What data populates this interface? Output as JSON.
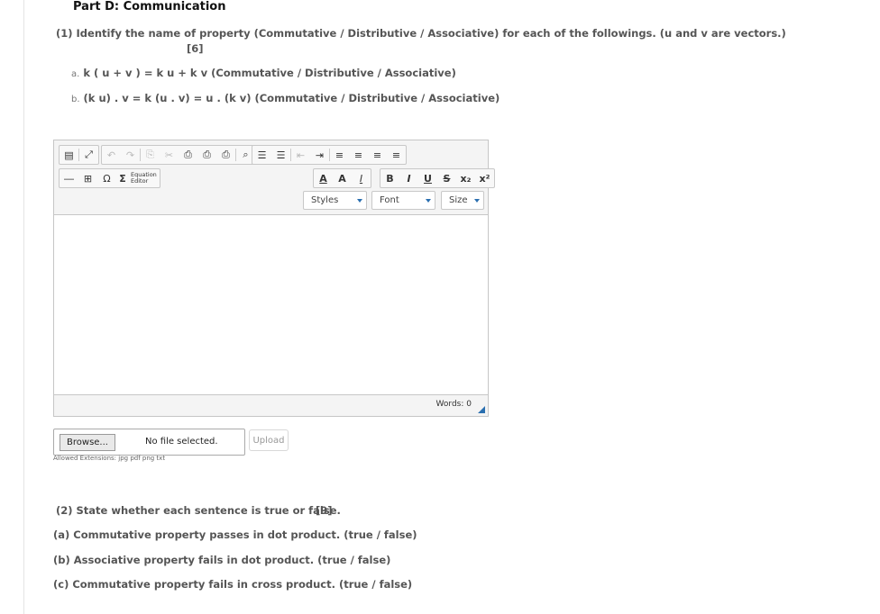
{
  "part_title": "Part D: Communication",
  "q1": {
    "prompt": "(1) Identify the name of property (Commutative / Distributive / Associative) for each of the followings. (u and v are vectors.)",
    "marks": "[6]",
    "items": [
      {
        "marker": "a.",
        "text": "k ( u + v ) = k u + k v  (Commutative / Distributive / Associative)"
      },
      {
        "marker": "b.",
        "text": "(k u) . v = k (u . v) = u . (k v) (Commutative / Distributive / Associative)"
      }
    ]
  },
  "editor": {
    "equation_label_1": "Equation",
    "equation_label_2": "Editor",
    "styles": "Styles",
    "font": "Font",
    "size": "Size",
    "words": "Words: 0",
    "icons": {
      "source": "▤",
      "maximize": "⤢",
      "undo": "↶",
      "redo": "↷",
      "copy": "⎘",
      "cut": "✂",
      "paste": "⎙",
      "paste_text": "⎙",
      "paste_word": "⎙",
      "find": "⌕",
      "ol": "☰",
      "ul": "☰",
      "outdent": "⇤",
      "indent": "⇥",
      "align_left": "≡",
      "align_center": "≡",
      "align_right": "≡",
      "justify": "≡",
      "hr": "―",
      "table": "⊞",
      "omega": "Ω",
      "sigma": "Σ",
      "text_color": "A",
      "bg_color": "A",
      "remove_format": "I",
      "bold": "B",
      "italic": "I",
      "underline": "U",
      "strike": "S",
      "subscript": "x₂",
      "superscript": "x²"
    }
  },
  "upload": {
    "browse": "Browse...",
    "no_file": "No file selected.",
    "upload_button": "Upload",
    "allowed": "Allowed Extensions: jpg pdf png txt"
  },
  "q2": {
    "prompt": "(2) State whether each sentence is true or false.",
    "marks": "[9]",
    "items": [
      "(a) Commutative property passes in dot product.  (true / false)",
      "(b) Associative property fails in dot product.  (true / false)",
      "(c) Commutative property fails in cross product.  (true / false)"
    ]
  }
}
